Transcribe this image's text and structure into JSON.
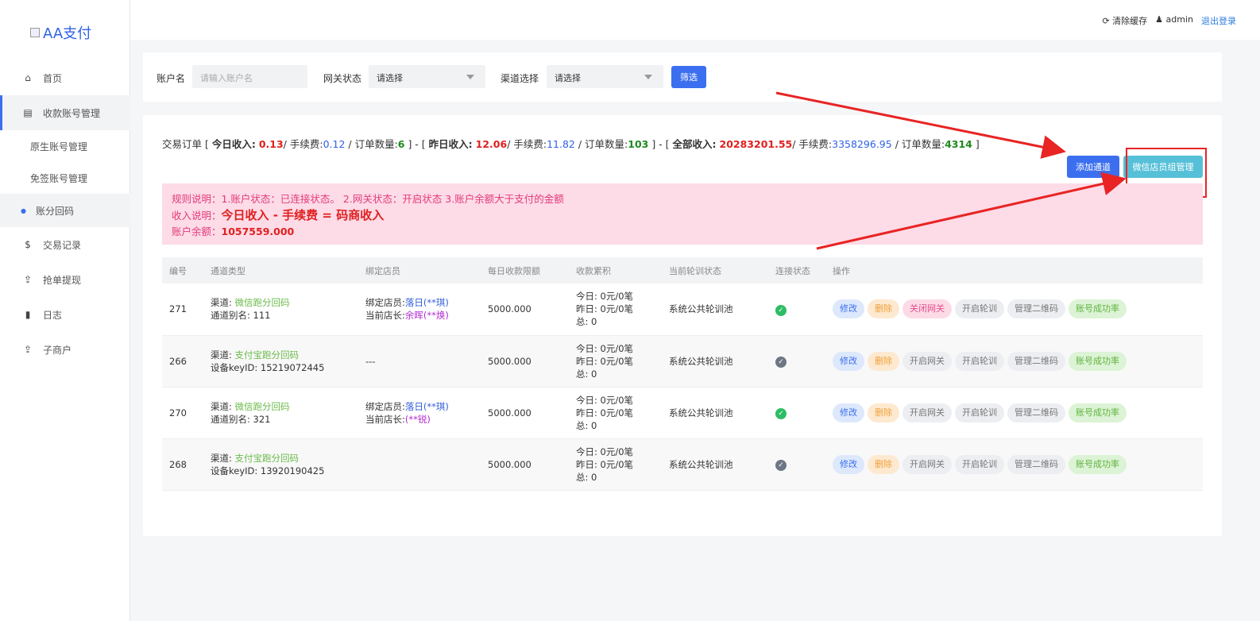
{
  "app": {
    "logo_text": "AA支付"
  },
  "topbar": {
    "clear_cache": "清除缓存",
    "user": "admin",
    "logout": "退出登录"
  },
  "sidebar": {
    "items": [
      {
        "label": "首页",
        "icon": "home-icon"
      },
      {
        "label": "收款账号管理",
        "icon": "document-icon"
      },
      {
        "label": "原生账号管理"
      },
      {
        "label": "免签账号管理"
      },
      {
        "label": "账分回码"
      },
      {
        "label": "交易记录",
        "icon": "dollar-icon"
      },
      {
        "label": "抢单提现",
        "icon": "upload-icon"
      },
      {
        "label": "日志",
        "icon": "book-icon"
      },
      {
        "label": "子商户",
        "icon": "upload-icon"
      }
    ]
  },
  "filter": {
    "account_label": "账户名",
    "account_placeholder": "请输入账户名",
    "gateway_label": "网关状态",
    "gateway_value": "请选择",
    "channel_label": "渠道选择",
    "channel_value": "请选择",
    "filter_button": "筛选"
  },
  "summary": {
    "prefix": "交易订单 [ ",
    "today_label": "今日收入:",
    "today_income": "0.13",
    "today_fee_label": "/ 手续费:",
    "today_fee": "0.12",
    "today_count_label": " / 订单数量:",
    "today_count": "6",
    "sep1": " ] - [ ",
    "yesterday_label": "昨日收入:",
    "yesterday_income": "12.06",
    "yesterday_fee_label": "/ 手续费:",
    "yesterday_fee": "11.82",
    "yesterday_count_label": " / 订单数量:",
    "yesterday_count": "103",
    "sep2": " ] - [ ",
    "all_label": "全部收入:",
    "all_income": "20283201.55",
    "all_fee_label": "/ 手续费:",
    "all_fee": "3358296.95",
    "all_count_label": " / 订单数量:",
    "all_count": "4314",
    "suffix": " ]"
  },
  "actions": {
    "add_channel": "添加通道",
    "wechat_staff": "微信店员组管理"
  },
  "notice": {
    "rule": "规则说明：1.账户状态：已连接状态。 2.网关状态：开启状态 3.账户余额大于支付的金额",
    "income_label": "收入说明：",
    "income_formula": "今日收入 - 手续费 = 码商收入",
    "balance_label": "账户余额：",
    "balance": "1057559.000"
  },
  "table": {
    "headers": [
      "编号",
      "通道类型",
      "绑定店员",
      "每日收款限额",
      "收款累积",
      "当前轮训状态",
      "连接状态",
      "操作"
    ],
    "rows": [
      {
        "id": "271",
        "channel_label": "渠道: ",
        "channel": "微信跑分回码",
        "sub_label": "通道别名: ",
        "sub": "111",
        "bind1_label": "绑定店员:",
        "bind1": "落日(**琪)",
        "bind2_label": "当前店长:",
        "bind2": "余晖(**焕)",
        "limit": "5000.000",
        "today": "今日: 0元/0笔",
        "yesterday": "昨日: 0元/0笔",
        "total": "总: 0",
        "poll": "系统公共轮训池",
        "connected": true,
        "ops": [
          "修改",
          "删除",
          "关闭网关",
          "开启轮训",
          "管理二维码",
          "账号成功率"
        ]
      },
      {
        "id": "266",
        "channel_label": "渠道: ",
        "channel": "支付宝跑分回码",
        "sub_label": "设备keyID: ",
        "sub": "15219072445",
        "bind1_label": "",
        "bind1": "",
        "bind2_label": "",
        "bind2": "",
        "bind_empty": "---",
        "limit": "5000.000",
        "today": "今日: 0元/0笔",
        "yesterday": "昨日: 0元/0笔",
        "total": "总: 0",
        "poll": "系统公共轮训池",
        "connected": false,
        "ops": [
          "修改",
          "删除",
          "开启网关",
          "开启轮训",
          "管理二维码",
          "账号成功率"
        ]
      },
      {
        "id": "270",
        "channel_label": "渠道: ",
        "channel": "微信跑分回码",
        "sub_label": "通道别名: ",
        "sub": "321",
        "bind1_label": "绑定店员:",
        "bind1": "落日(**琪)",
        "bind2_label": "当前店长:",
        "bind2": "(**锐)",
        "limit": "5000.000",
        "today": "今日: 0元/0笔",
        "yesterday": "昨日: 0元/0笔",
        "total": "总: 0",
        "poll": "系统公共轮训池",
        "connected": true,
        "ops": [
          "修改",
          "删除",
          "开启网关",
          "开启轮训",
          "管理二维码",
          "账号成功率"
        ]
      },
      {
        "id": "268",
        "channel_label": "渠道: ",
        "channel": "支付宝跑分回码",
        "sub_label": "设备keyID: ",
        "sub": "13920190425",
        "bind1_label": "",
        "bind1": "",
        "bind2_label": "",
        "bind2": "",
        "bind_empty": "",
        "limit": "5000.000",
        "today": "今日: 0元/0笔",
        "yesterday": "昨日: 0元/0笔",
        "total": "总: 0",
        "poll": "系统公共轮训池",
        "connected": false,
        "ops": [
          "修改",
          "删除",
          "开启网关",
          "开启轮训",
          "管理二维码",
          "账号成功率"
        ]
      }
    ]
  },
  "colors": {
    "accent": "#3b6ff0",
    "income_red": "#e02020",
    "count_green": "#1e8a1e",
    "notice_bg": "#fddbe7",
    "annotation_red": "#e82424"
  }
}
